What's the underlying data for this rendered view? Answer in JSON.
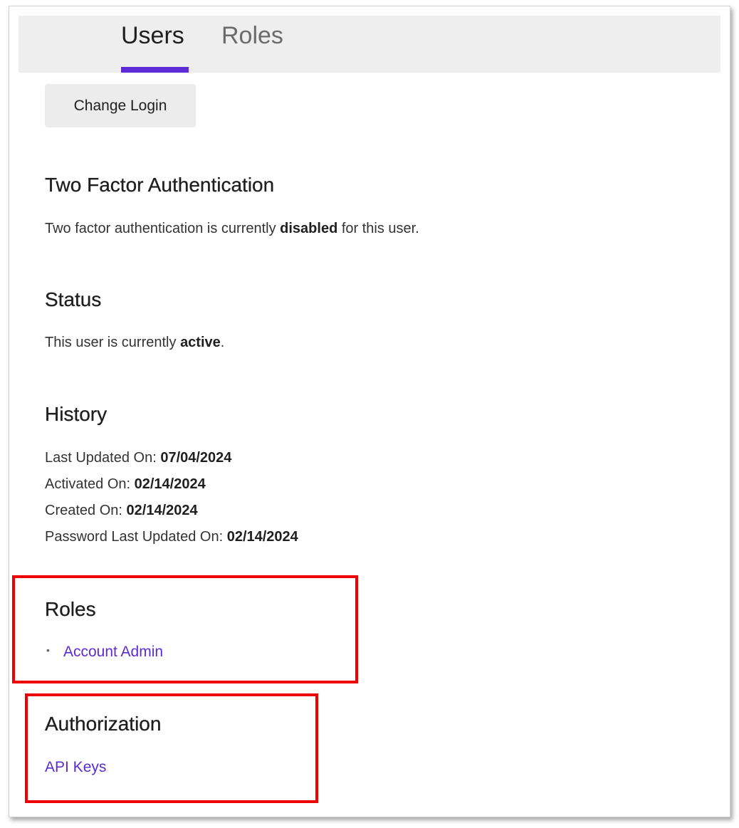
{
  "tabs": [
    {
      "label": "Users",
      "active": true
    },
    {
      "label": "Roles",
      "active": false
    }
  ],
  "change_login_button": "Change Login",
  "two_factor": {
    "heading": "Two Factor Authentication",
    "text_before": "Two factor authentication is currently ",
    "state": "disabled",
    "text_after": " for this user."
  },
  "status": {
    "heading": "Status",
    "text_before": "This user is currently ",
    "state": "active",
    "text_after": "."
  },
  "history": {
    "heading": "History",
    "rows": [
      {
        "label": "Last Updated On: ",
        "value": "07/04/2024"
      },
      {
        "label": "Activated On: ",
        "value": "02/14/2024"
      },
      {
        "label": "Created On: ",
        "value": "02/14/2024"
      },
      {
        "label": "Password Last Updated On: ",
        "value": "02/14/2024"
      }
    ]
  },
  "roles": {
    "heading": "Roles",
    "items": [
      "Account Admin"
    ]
  },
  "authorization": {
    "heading": "Authorization",
    "link": "API Keys"
  },
  "colors": {
    "accent": "#5b2bd6",
    "highlight_box": "#ee0000",
    "tabbar_bg": "#eeeeee"
  }
}
